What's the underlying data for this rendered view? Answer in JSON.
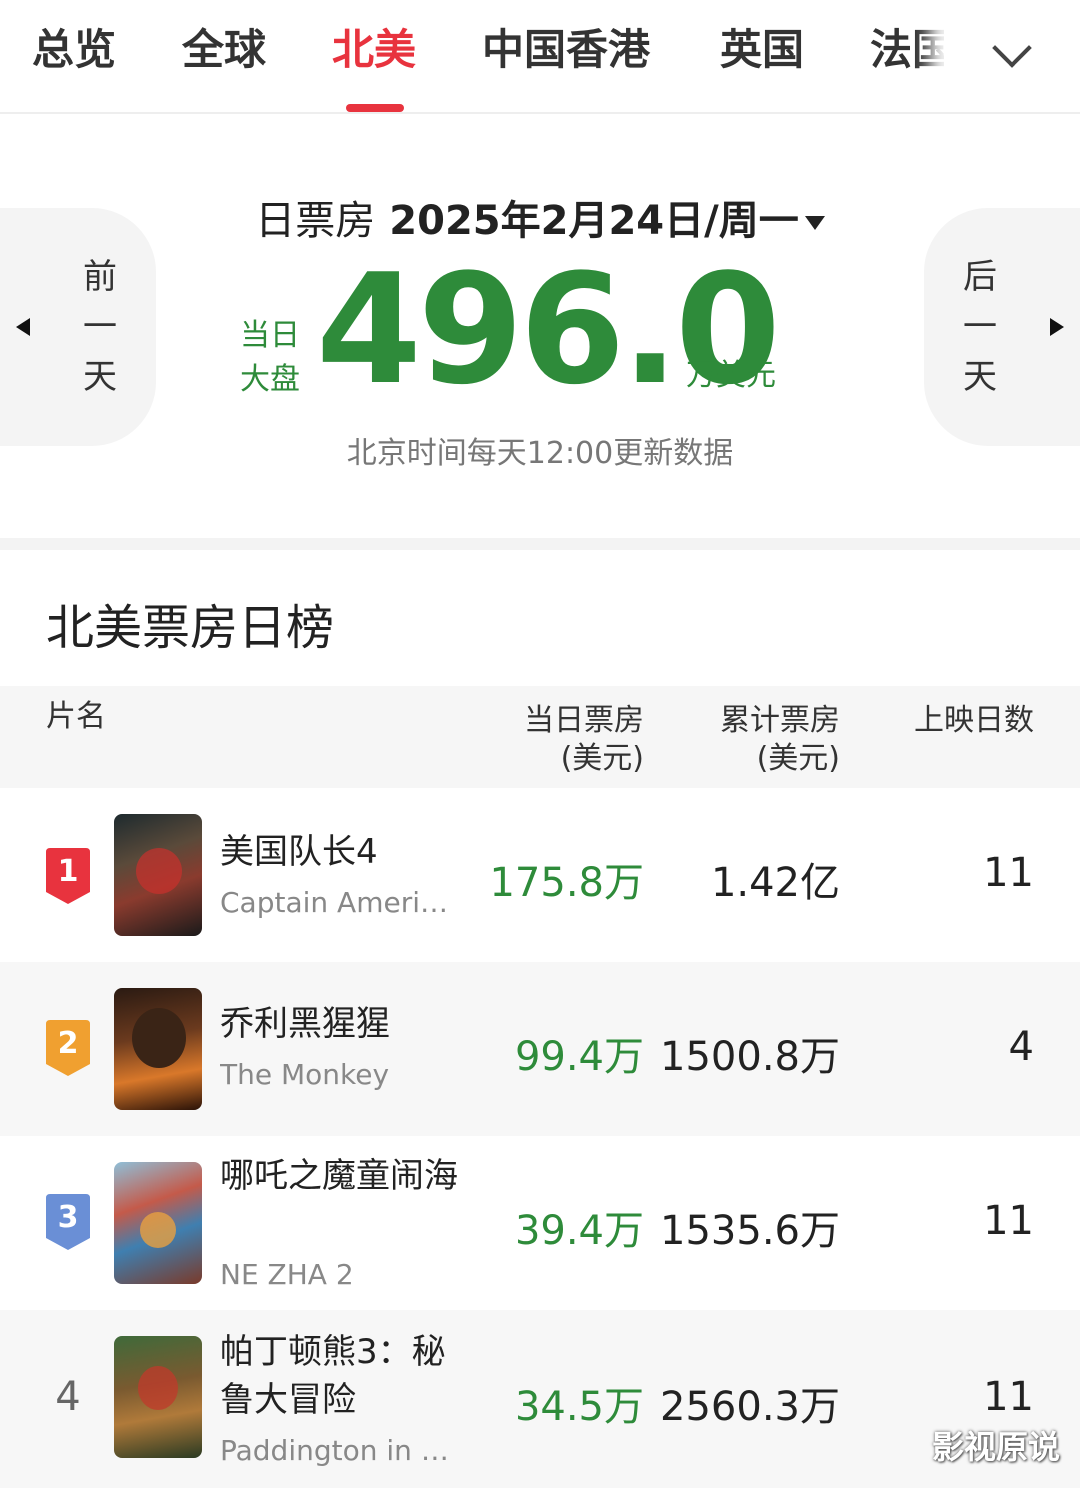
{
  "tabs": [
    "总览",
    "全球",
    "北美",
    "中国香港",
    "英国",
    "法国"
  ],
  "active_tab": "北美",
  "summary": {
    "date_label": "日票房",
    "date": "2025年2月24日/周一",
    "prev": [
      "前",
      "一",
      "天"
    ],
    "next": [
      "后",
      "一",
      "天"
    ],
    "total_label_1": "当日",
    "total_label_2": "大盘",
    "total_value": "496.0",
    "total_unit": "万美元",
    "update_note": "北京时间每天12:00更新数据"
  },
  "section_title": "北美票房日榜",
  "table": {
    "headers": {
      "name": "片名",
      "daily_1": "当日票房",
      "daily_2": "(美元)",
      "total_1": "累计票房",
      "total_2": "(美元)",
      "days": "上映日数"
    },
    "rows": [
      {
        "rank": "1",
        "title_cn": "美国队长4",
        "title_en": "Captain Americ...",
        "daily": "175.8万",
        "total": "1.42亿",
        "days": "11"
      },
      {
        "rank": "2",
        "title_cn": "乔利黑猩猩",
        "title_en": "The Monkey",
        "daily": "99.4万",
        "total": "1500.8万",
        "days": "4"
      },
      {
        "rank": "3",
        "title_cn": "哪吒之魔童闹海",
        "title_en": "NE ZHA 2",
        "daily": "39.4万",
        "total": "1535.6万",
        "days": "11"
      },
      {
        "rank": "4",
        "title_cn": "帕丁顿熊3：秘鲁大冒险",
        "title_en": "Paddington in P...",
        "daily": "34.5万",
        "total": "2560.3万",
        "days": "11"
      }
    ]
  },
  "watermark": "影视原说",
  "colors": {
    "accent": "#e8333e",
    "green": "#2e8b3a",
    "rank1": "#e8333e",
    "rank2": "#f0a030",
    "rank3": "#6a8fd6"
  },
  "icons": {
    "more": "chevron-down-icon",
    "prev": "triangle-left-icon",
    "next": "triangle-right-icon"
  }
}
